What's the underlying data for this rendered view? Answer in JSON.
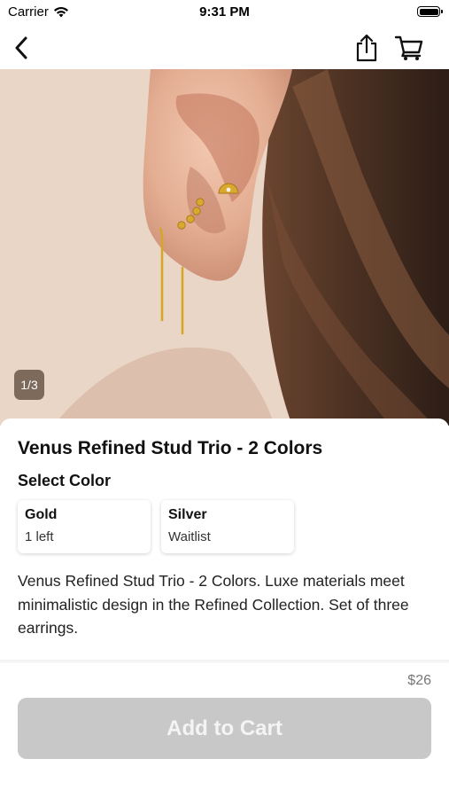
{
  "status_bar": {
    "carrier": "Carrier",
    "time": "9:31 PM"
  },
  "nav": {
    "back_icon": "chevron-left-icon",
    "share_icon": "share-icon",
    "cart_icon": "cart-icon"
  },
  "gallery": {
    "counter": "1/3"
  },
  "product": {
    "title": "Venus Refined Stud Trio - 2 Colors",
    "select_color_label": "Select Color",
    "colors": [
      {
        "name": "Gold",
        "status": "1 left"
      },
      {
        "name": "Silver",
        "status": "Waitlist"
      }
    ],
    "description": "Venus Refined Stud Trio - 2 Colors. Luxe materials meet minimalistic design in the Refined Collection. Set of three earrings.",
    "price": "$26"
  },
  "cart_button": {
    "label": "Add to Cart",
    "enabled": false
  },
  "colors": {
    "button_disabled_bg": "#c8c8c8",
    "gold": "#d8a92e"
  }
}
